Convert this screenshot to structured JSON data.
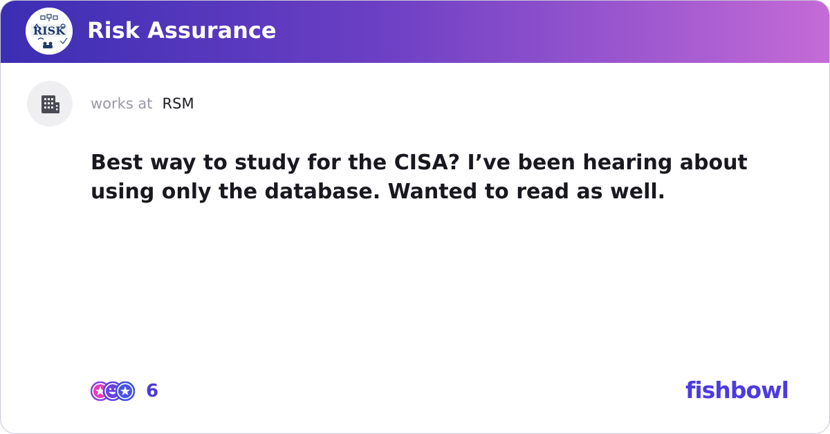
{
  "header": {
    "bowl_name": "Risk Assurance",
    "logo_label": "RISK",
    "logo_icon": "risk-bowl-logo"
  },
  "author": {
    "avatar_icon": "building-icon",
    "works_at": "works at",
    "company": "RSM"
  },
  "post": {
    "text": "Best way to study for the CISA? I’ve been hearing about using only the database. Wanted to read as well."
  },
  "reactions": {
    "icons": [
      "star-reaction-icon",
      "laugh-reaction-icon",
      "star-reaction-icon"
    ],
    "count": "6"
  },
  "brand": {
    "name": "fishbowl",
    "color": "#4c3be0"
  },
  "colors": {
    "header_start": "#3b2eb3",
    "header_end": "#c46bd6",
    "accent": "#4c3be0"
  }
}
